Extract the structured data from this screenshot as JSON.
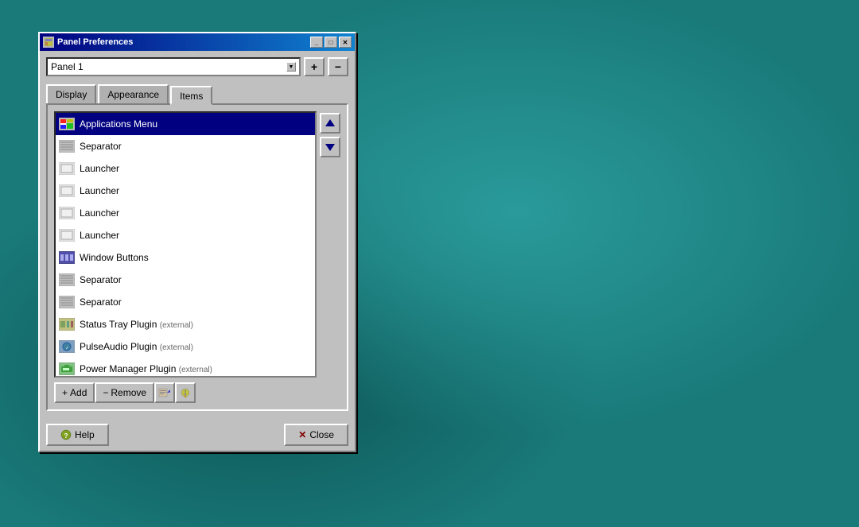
{
  "window": {
    "title": "Panel Preferences",
    "icon": "⚙"
  },
  "titlebar": {
    "minimize_label": "_",
    "maximize_label": "□",
    "close_label": "✕"
  },
  "panel_selector": {
    "value": "Panel 1",
    "add_label": "+",
    "remove_label": "−"
  },
  "tabs": [
    {
      "id": "display",
      "label": "Display",
      "active": false
    },
    {
      "id": "appearance",
      "label": "Appearance",
      "active": false
    },
    {
      "id": "items",
      "label": "Items",
      "active": true
    }
  ],
  "items_list": [
    {
      "id": 1,
      "label": "Applications Menu",
      "icon_type": "app-menu",
      "selected": true,
      "external": ""
    },
    {
      "id": 2,
      "label": "Separator",
      "icon_type": "separator",
      "selected": false,
      "external": ""
    },
    {
      "id": 3,
      "label": "Launcher",
      "icon_type": "launcher",
      "selected": false,
      "external": ""
    },
    {
      "id": 4,
      "label": "Launcher",
      "icon_type": "launcher",
      "selected": false,
      "external": ""
    },
    {
      "id": 5,
      "label": "Launcher",
      "icon_type": "launcher",
      "selected": false,
      "external": ""
    },
    {
      "id": 6,
      "label": "Launcher",
      "icon_type": "launcher",
      "selected": false,
      "external": ""
    },
    {
      "id": 7,
      "label": "Window Buttons",
      "icon_type": "window-buttons",
      "selected": false,
      "external": ""
    },
    {
      "id": 8,
      "label": "Separator",
      "icon_type": "separator",
      "selected": false,
      "external": ""
    },
    {
      "id": 9,
      "label": "Separator",
      "icon_type": "separator",
      "selected": false,
      "external": ""
    },
    {
      "id": 10,
      "label": "Status Tray Plugin",
      "icon_type": "status-tray",
      "selected": false,
      "external": "(external)"
    },
    {
      "id": 11,
      "label": "PulseAudio Plugin",
      "icon_type": "pulse",
      "selected": false,
      "external": "(external)"
    },
    {
      "id": 12,
      "label": "Power Manager Plugin",
      "icon_type": "power",
      "selected": false,
      "external": "(external)"
    }
  ],
  "arrow_buttons": {
    "up_label": "▲",
    "down_label": "▼"
  },
  "actions": {
    "add_label": "+ Add",
    "remove_label": "− Remove"
  },
  "bottom_buttons": {
    "help_label": "Help",
    "close_label": "Close"
  }
}
